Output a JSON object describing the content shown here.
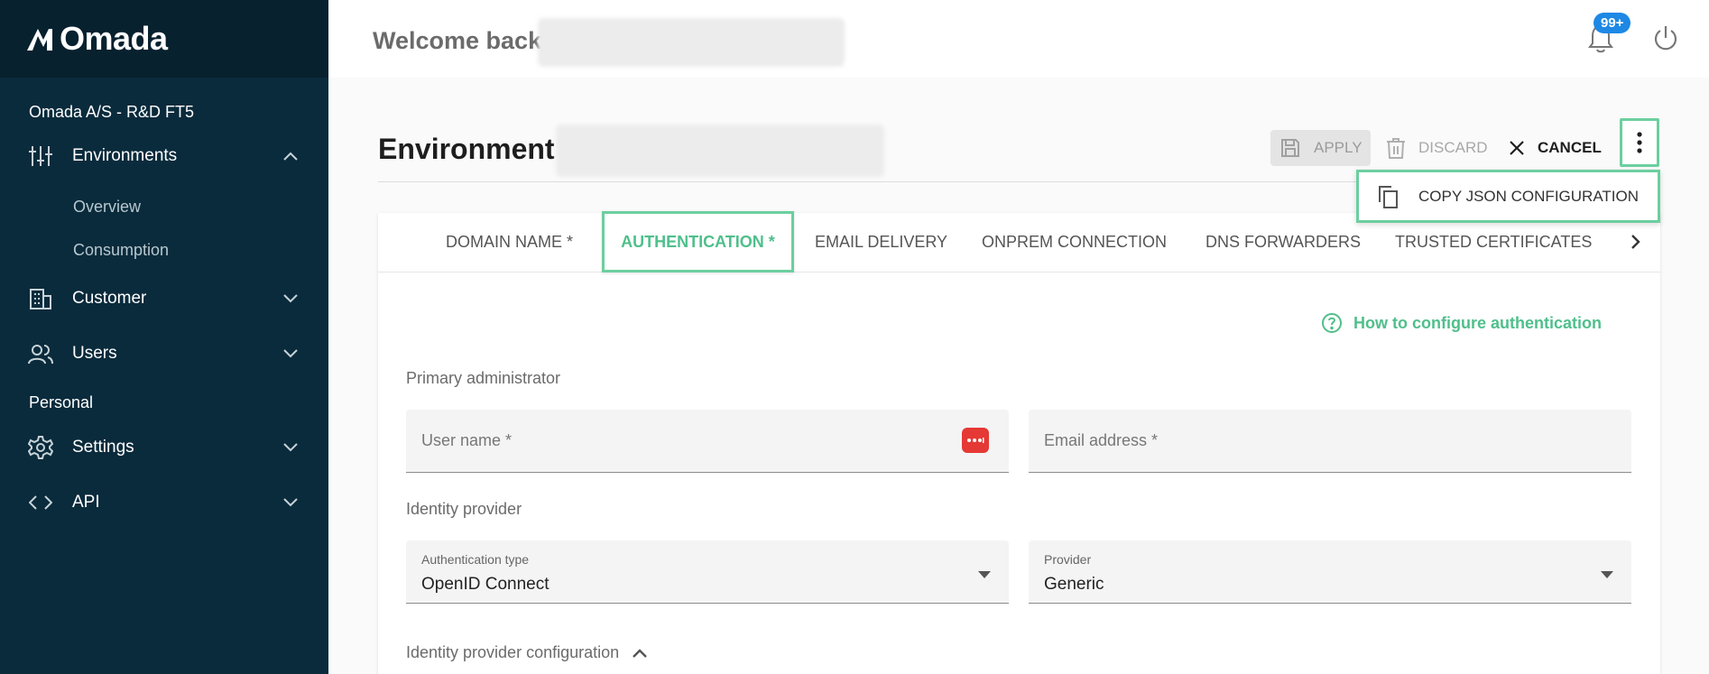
{
  "app": {
    "logo_text": "Omada"
  },
  "sidebar": {
    "org": "Omada A/S - R&D FT5",
    "items": [
      {
        "label": "Environments",
        "icon": "sliders-icon",
        "expanded": true,
        "children": [
          {
            "label": "Overview"
          },
          {
            "label": "Consumption"
          }
        ]
      },
      {
        "label": "Customer",
        "icon": "building-icon",
        "expanded": false
      },
      {
        "label": "Users",
        "icon": "users-icon",
        "expanded": false
      }
    ],
    "personal_label": "Personal",
    "personal_items": [
      {
        "label": "Settings",
        "icon": "gear-icon",
        "expanded": false
      },
      {
        "label": "API",
        "icon": "code-icon",
        "expanded": false
      }
    ]
  },
  "header": {
    "welcome": "Welcome back",
    "notifications_badge": "99+"
  },
  "page": {
    "title": "Environment",
    "actions": {
      "apply": "APPLY",
      "discard": "DISCARD",
      "cancel": "CANCEL"
    },
    "menu": {
      "copy_json": "COPY JSON CONFIGURATION"
    }
  },
  "tabs": [
    {
      "label": "DOMAIN NAME *"
    },
    {
      "label": "AUTHENTICATION *",
      "active": true
    },
    {
      "label": "EMAIL DELIVERY"
    },
    {
      "label": "ONPREM CONNECTION"
    },
    {
      "label": "DNS FORWARDERS"
    },
    {
      "label": "TRUSTED CERTIFICATES"
    }
  ],
  "auth": {
    "help_link": "How to configure authentication",
    "primary_admin_title": "Primary administrator",
    "username_placeholder": "User name *",
    "email_placeholder": "Email address *",
    "idp_title": "Identity provider",
    "auth_type_label": "Authentication type",
    "auth_type_value": "OpenID Connect",
    "provider_label": "Provider",
    "provider_value": "Generic",
    "idp_config_title": "Identity provider configuration"
  },
  "colors": {
    "sidebar": "#0a2b3c",
    "accent": "#4fbf8b",
    "highlight": "#6ccf9f",
    "badge": "#1e88e5"
  }
}
